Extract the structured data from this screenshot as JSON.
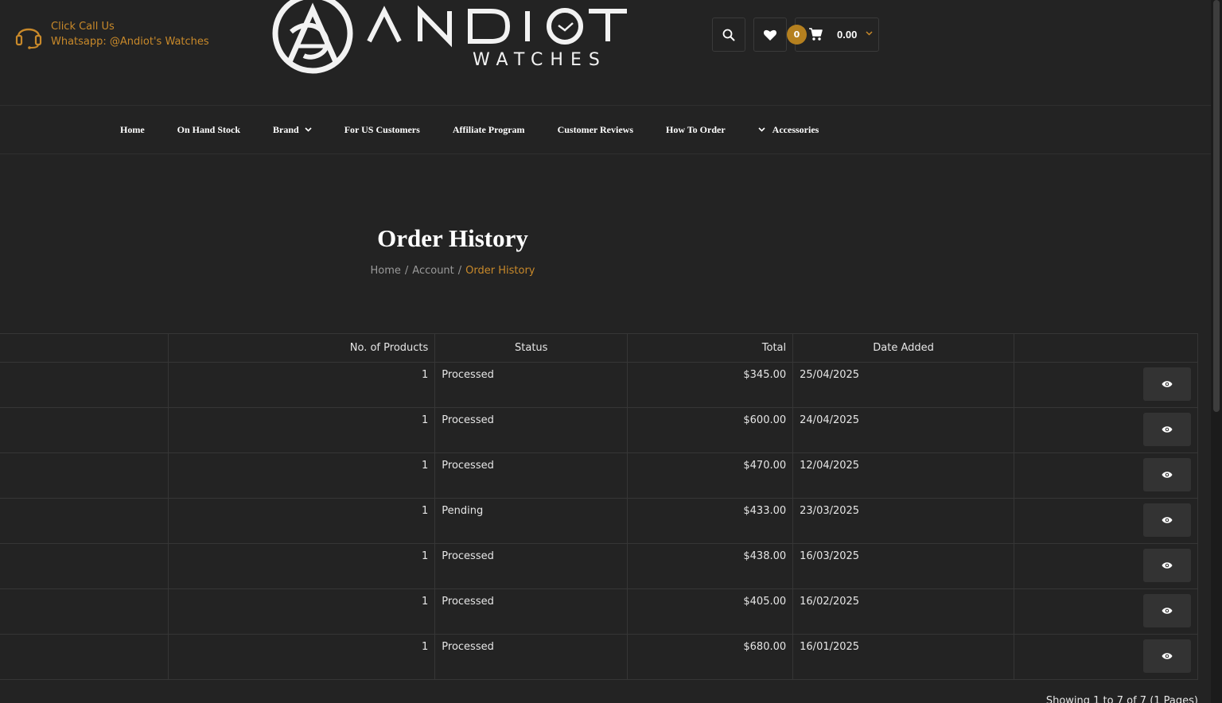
{
  "header": {
    "contact_line1": "Click Call Us",
    "contact_line2": "Whatsapp: @Andiot's Watches",
    "logo_name": "ANDIOT",
    "logo_sub": "WATCHES",
    "cart_count": "0",
    "cart_total": "0.00",
    "icons": [
      "headset-icon",
      "search-icon",
      "heart-icon",
      "cart-icon",
      "chevron-down-icon"
    ]
  },
  "nav": {
    "items": [
      {
        "label": "Home"
      },
      {
        "label": "On Hand Stock"
      },
      {
        "label": "Brand"
      },
      {
        "label": "For US Customers"
      },
      {
        "label": "Affiliate Program"
      },
      {
        "label": "Customer Reviews"
      },
      {
        "label": "How To Order"
      },
      {
        "label": "Accessories"
      }
    ]
  },
  "page": {
    "title": "Order History",
    "breadcrumb": [
      "Home",
      "Account",
      "Order History"
    ],
    "breadcrumb_sep": "/"
  },
  "table": {
    "headers": [
      "",
      "No. of Products",
      "Status",
      "Total",
      "Date Added",
      ""
    ],
    "rows": [
      {
        "order_id": "",
        "products": "1",
        "status": "Processed",
        "total": "$345.00",
        "date": "25/04/2025"
      },
      {
        "order_id": "",
        "products": "1",
        "status": "Processed",
        "total": "$600.00",
        "date": "24/04/2025"
      },
      {
        "order_id": "",
        "products": "1",
        "status": "Processed",
        "total": "$470.00",
        "date": "12/04/2025"
      },
      {
        "order_id": "",
        "products": "1",
        "status": "Pending",
        "total": "$433.00",
        "date": "23/03/2025"
      },
      {
        "order_id": "",
        "products": "1",
        "status": "Processed",
        "total": "$438.00",
        "date": "16/03/2025"
      },
      {
        "order_id": "",
        "products": "1",
        "status": "Processed",
        "total": "$405.00",
        "date": "16/02/2025"
      },
      {
        "order_id": "",
        "products": "1",
        "status": "Processed",
        "total": "$680.00",
        "date": "16/01/2025"
      }
    ],
    "view_icon": "eye-icon",
    "pagination_text": "Showing 1 to 7 of 7 (1 Pages)"
  },
  "colors": {
    "background": "#232323",
    "accent": "#c8892a",
    "badge": "#b5801f",
    "border": "#363636"
  }
}
